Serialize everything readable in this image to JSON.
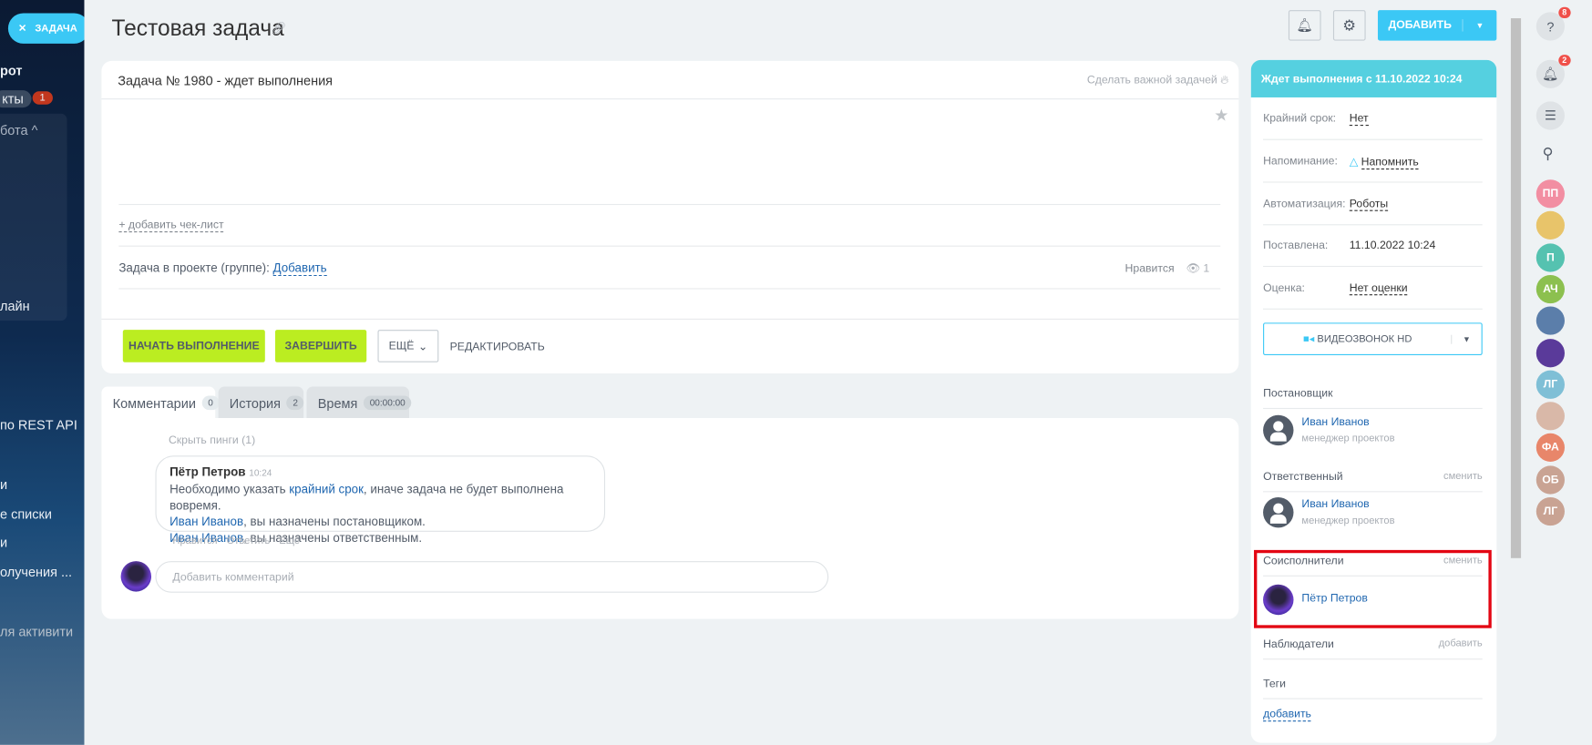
{
  "leftbar": {
    "close_label": "ЗАДАЧА",
    "items": [
      "рот",
      "кты",
      "бота",
      "лайн",
      "по REST API",
      "и",
      "е списки",
      "и",
      "олучения ...",
      "ля активити"
    ],
    "badge": "1"
  },
  "header": {
    "title": "Тестовая задача",
    "add_label": "ДОБАВИТЬ"
  },
  "task": {
    "heading": "Задача № 1980 - ждет выполнения",
    "make_important": "Сделать важной задачей",
    "add_checklist": "+ добавить чек-лист",
    "project_label": "Задача в проекте (группе):",
    "project_add": "Добавить",
    "like": "Нравится",
    "views": "1",
    "buttons": {
      "start": "НАЧАТЬ ВЫПОЛНЕНИЕ",
      "finish": "ЗАВЕРШИТЬ",
      "more": "ЕЩЁ",
      "edit": "РЕДАКТИРОВАТЬ"
    }
  },
  "tabs": [
    {
      "label": "Комментарии",
      "count": "0"
    },
    {
      "label": "История",
      "count": "2"
    },
    {
      "label": "Время",
      "count": "00:00:00"
    }
  ],
  "comments": {
    "hide_pings": "Скрыть пинги (1)",
    "author": "Пётр Петров",
    "time": "10:24",
    "line1_a": "Необходимо указать ",
    "line1_link": "крайний срок",
    "line1_b": ", иначе задача не будет выполнена вовремя.",
    "line2_link": "Иван Иванов",
    "line2_b": ", вы назначены постановщиком.",
    "line3_link": "Иван Иванов",
    "line3_b": ", вы назначены ответственным.",
    "actions": [
      "Нравится",
      "Ответить",
      "Ещё"
    ],
    "input_placeholder": "Добавить комментарий"
  },
  "sidebar": {
    "status": "Ждет выполнения с 11.10.2022 10:24",
    "fields": [
      {
        "label": "Крайний срок:",
        "value": "Нет"
      },
      {
        "label": "Напоминание:",
        "value": "Напомнить"
      },
      {
        "label": "Автоматизация:",
        "value": "Роботы"
      },
      {
        "label": "Поставлена:",
        "value": "11.10.2022 10:24"
      },
      {
        "label": "Оценка:",
        "value": "Нет оценки"
      }
    ],
    "video_call": "ВИДЕОЗВОНОК HD",
    "creator": {
      "title": "Постановщик",
      "name": "Иван Иванов",
      "role": "менеджер проектов"
    },
    "responsible": {
      "title": "Ответственный",
      "action": "сменить",
      "name": "Иван Иванов",
      "role": "менеджер проектов"
    },
    "accomplices": {
      "title": "Соисполнители",
      "action": "сменить",
      "name": "Пётр Петров"
    },
    "auditors": {
      "title": "Наблюдатели",
      "action": "добавить"
    },
    "tags": {
      "title": "Теги",
      "action": "добавить"
    }
  },
  "rightbar": {
    "help_badge": "8",
    "notif_badge": "2",
    "avatars": [
      {
        "initials": "ПП",
        "color": "#f28ea2"
      },
      {
        "initials": "",
        "color": "#e8c46a"
      },
      {
        "initials": "П",
        "color": "#55c2b0"
      },
      {
        "initials": "АЧ",
        "color": "#8cc04f"
      },
      {
        "initials": "",
        "color": "#5b7eaa"
      },
      {
        "initials": "",
        "color": "#5a3a9a"
      },
      {
        "initials": "ЛГ",
        "color": "#7fbfd6"
      },
      {
        "initials": "",
        "color": "#d9b8a8"
      },
      {
        "initials": "ФА",
        "color": "#e8866a"
      },
      {
        "initials": "ОБ",
        "color": "#c9a393"
      },
      {
        "initials": "ЛГ",
        "color": "#c9a393"
      }
    ]
  }
}
